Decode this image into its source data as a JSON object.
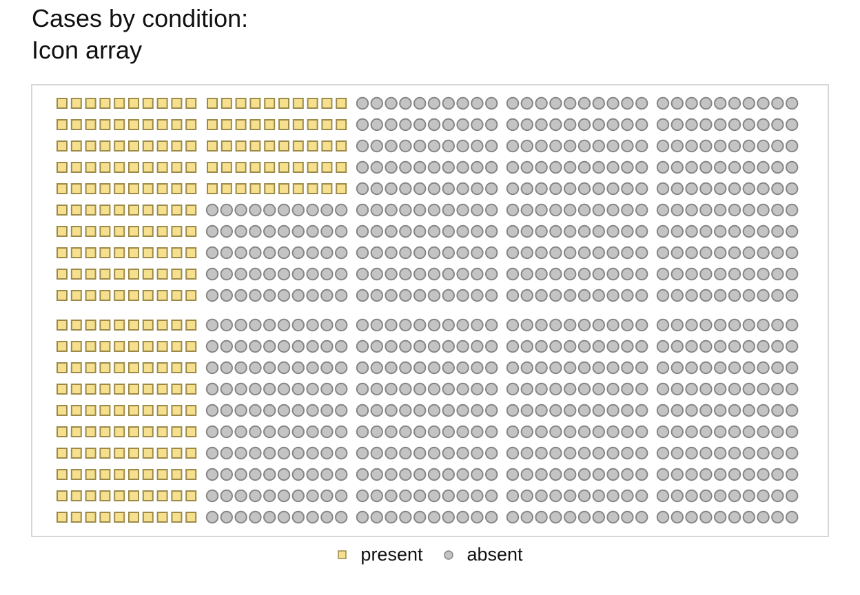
{
  "chart_data": {
    "type": "icon_array",
    "title_lines": [
      "Cases by condition:",
      "Icon array"
    ],
    "total": 1000,
    "rows": 20,
    "columns": 50,
    "block_size": 10,
    "fill_order": "column-major within 10x10 blocks",
    "series": [
      {
        "name": "present",
        "value": 250,
        "shape": "square",
        "fill": "#f6e08e",
        "stroke": "#9b8a4a"
      },
      {
        "name": "absent",
        "value": 750,
        "shape": "circle",
        "fill": "#c4c4c4",
        "stroke": "#858585"
      }
    ],
    "legend": {
      "position": "bottom-center",
      "entries": [
        "present",
        "absent"
      ]
    },
    "frame_color": "#c8c8c8"
  }
}
